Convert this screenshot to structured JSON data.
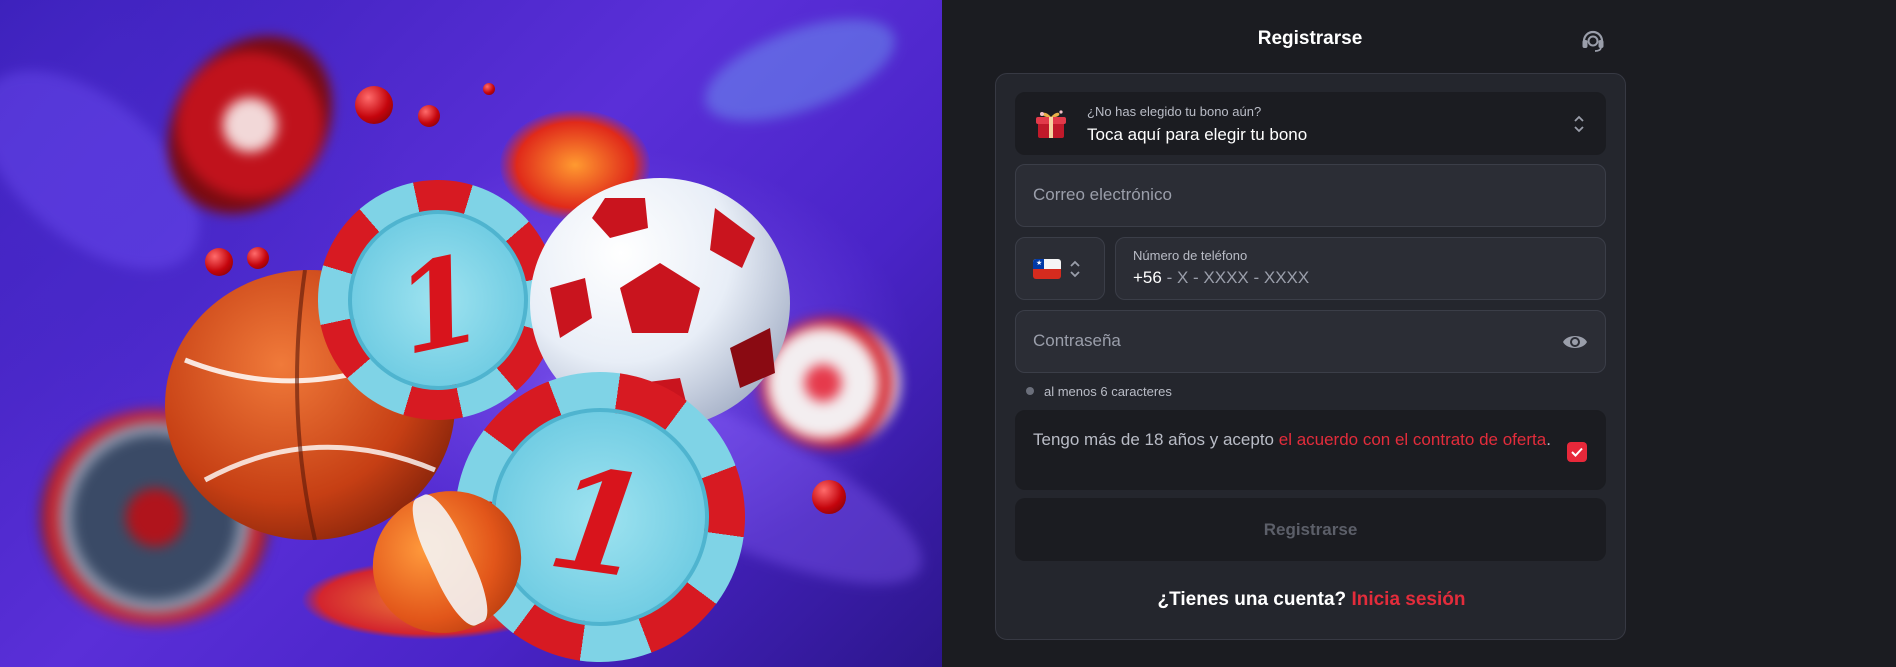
{
  "header": {
    "title": "Registrarse",
    "support_icon": "headset-icon"
  },
  "form": {
    "bonus": {
      "icon": "gift-icon",
      "label": "¿No has elegido tu bono aún?",
      "value": "Toca aquí para elegir tu bono"
    },
    "email": {
      "placeholder": "Correo electrónico"
    },
    "phone": {
      "country_flag": "chile-flag-icon",
      "label": "Número de teléfono",
      "code": "+56",
      "mask": " - X - XXXX - XXXX"
    },
    "password": {
      "placeholder": "Contraseña",
      "toggle_icon": "eye-icon"
    },
    "password_hint": "al menos 6 caracteres",
    "terms": {
      "text_before": "Tengo más de 18 años y acepto ",
      "link_text": "el acuerdo con el contrato de oferta",
      "text_after": ".",
      "checked": true
    },
    "submit_label": "Registrarse",
    "login_prompt": "¿Tienes una cuenta?",
    "login_link": "Inicia sesión"
  },
  "colors": {
    "accent": "#e32c3b",
    "panel": "#24262d",
    "background": "#1b1c21"
  }
}
